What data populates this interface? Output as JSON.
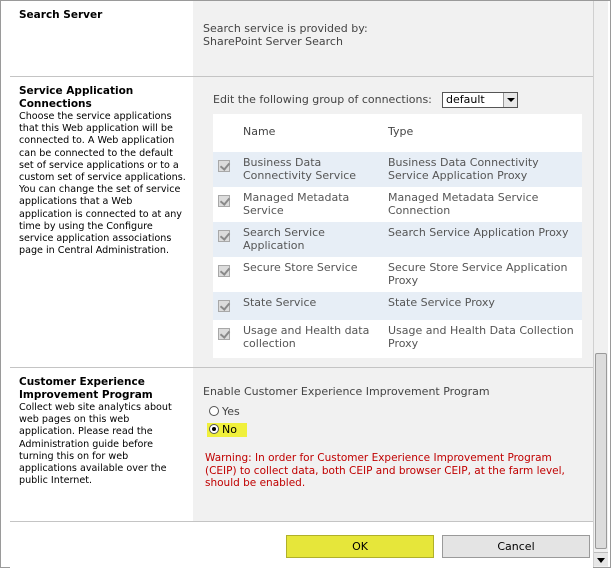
{
  "search_server": {
    "title": "Search Server",
    "description": "Search service is provided by:",
    "provider": "SharePoint Server Search"
  },
  "service_connections": {
    "title_line1": "Service Application",
    "title_line2": "Connections",
    "description": "Choose the service applications that this Web application will be connected to. A Web application can be connected to the default set of service applications or to a custom set of service applications. You can change the set of service applications that a Web application is connected to at any time by using the Configure service application associations page in Central Administration.",
    "group_label": "Edit the following group of connections:",
    "group_selected": "default",
    "columns": {
      "name": "Name",
      "type": "Type"
    },
    "rows": [
      {
        "name": "Business Data Connectivity Service",
        "type": "Business Data Connectivity Service Application Proxy"
      },
      {
        "name": "Managed Metadata Service",
        "type": "Managed Metadata Service Connection"
      },
      {
        "name": "Search Service Application",
        "type": "Search Service Application Proxy"
      },
      {
        "name": "Secure Store Service",
        "type": "Secure Store Service Application Proxy"
      },
      {
        "name": "State Service",
        "type": "State Service Proxy"
      },
      {
        "name": "Usage and Health data collection",
        "type": "Usage and Health Data Collection Proxy"
      }
    ]
  },
  "ceip": {
    "title_line1": "Customer Experience",
    "title_line2": "Improvement Program",
    "description": "Collect web site analytics about web pages on this web application. Please read the Administration guide before turning this on for web applications available over the public Internet.",
    "label": "Enable Customer Experience Improvement Program",
    "option_yes": "Yes",
    "option_no": "No",
    "selected": "No",
    "warning": "Warning: In order for Customer Experience Improvement Program (CEIP) to collect data, both CEIP and browser CEIP, at the farm level, should be enabled."
  },
  "buttons": {
    "ok": "OK",
    "cancel": "Cancel"
  },
  "colors": {
    "right_panel_bg": "#f1f1f1",
    "row_alt_bg": "#e7eef6",
    "highlight": "#f0f03c",
    "warning": "#c00000"
  }
}
